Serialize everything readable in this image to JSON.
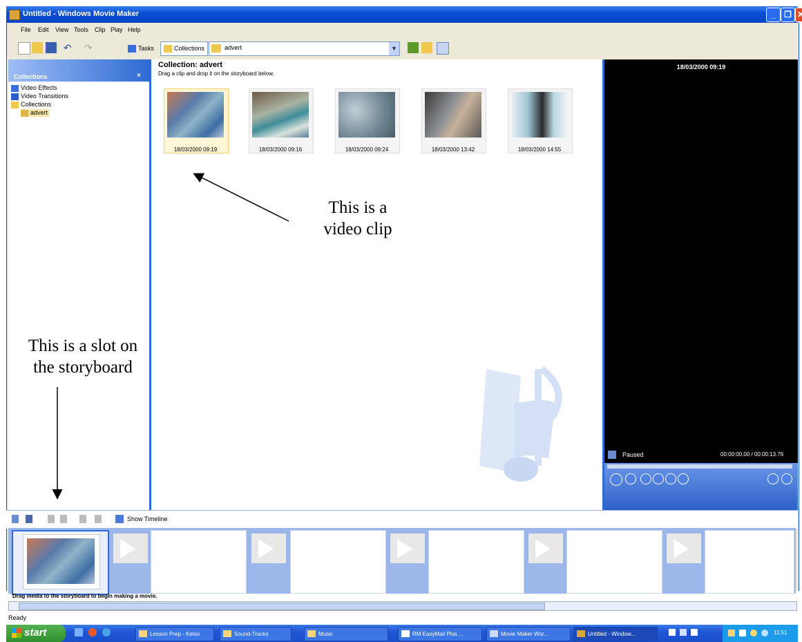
{
  "window": {
    "title": "Untitled - Windows Movie Maker",
    "buttons": [
      "_",
      "❐",
      "✕"
    ]
  },
  "menu": [
    "File",
    "Edit",
    "View",
    "Tools",
    "Clip",
    "Play",
    "Help"
  ],
  "toolbar": {
    "tasks_label": "Tasks",
    "collections_label": "Collections",
    "collection_combo_value": "advert"
  },
  "collections_pane": {
    "header": "Collections",
    "close": "×",
    "items": [
      "Video Effects",
      "Video Transitions",
      "Collections",
      "advert"
    ]
  },
  "content": {
    "title": "Collection: advert",
    "hint": "Drag a clip and drop it on the storyboard below.",
    "clips": [
      {
        "caption": "18/03/2000 09:19",
        "selected": true
      },
      {
        "caption": "18/03/2000 09:16",
        "selected": false
      },
      {
        "caption": "18/03/2000 09:24",
        "selected": false
      },
      {
        "caption": "18/03/2000 13:42",
        "selected": false
      },
      {
        "caption": "18/03/2000 14:55",
        "selected": false
      }
    ]
  },
  "preview": {
    "timestamp": "18/03/2000 09:19",
    "state": "Paused",
    "time": "00:00:00.00 / 00:00:13.76"
  },
  "storyboard_toolbar": {
    "show_timeline_label": "Show Timeline"
  },
  "storyboard": {
    "message": "Drag media to the storyboard to begin making a movie."
  },
  "status": "Ready",
  "taskbar": {
    "start_label": "start",
    "tasks": [
      {
        "label": "Lesson Prep - Kelso",
        "active": false
      },
      {
        "label": "Sound-Tracks",
        "active": false
      },
      {
        "label": "Music",
        "active": false
      },
      {
        "label": "RM EasyMail Plus ...",
        "active": false
      },
      {
        "label": "Movie Maker Wor...",
        "active": false
      },
      {
        "label": "Untitled - Window...",
        "active": true
      }
    ],
    "clock": "11:51"
  },
  "annotations": {
    "clip_note_line1": "This is a",
    "clip_note_line2": "video clip",
    "slot_note_line1": "This is a slot on",
    "slot_note_line2": "the storyboard"
  }
}
